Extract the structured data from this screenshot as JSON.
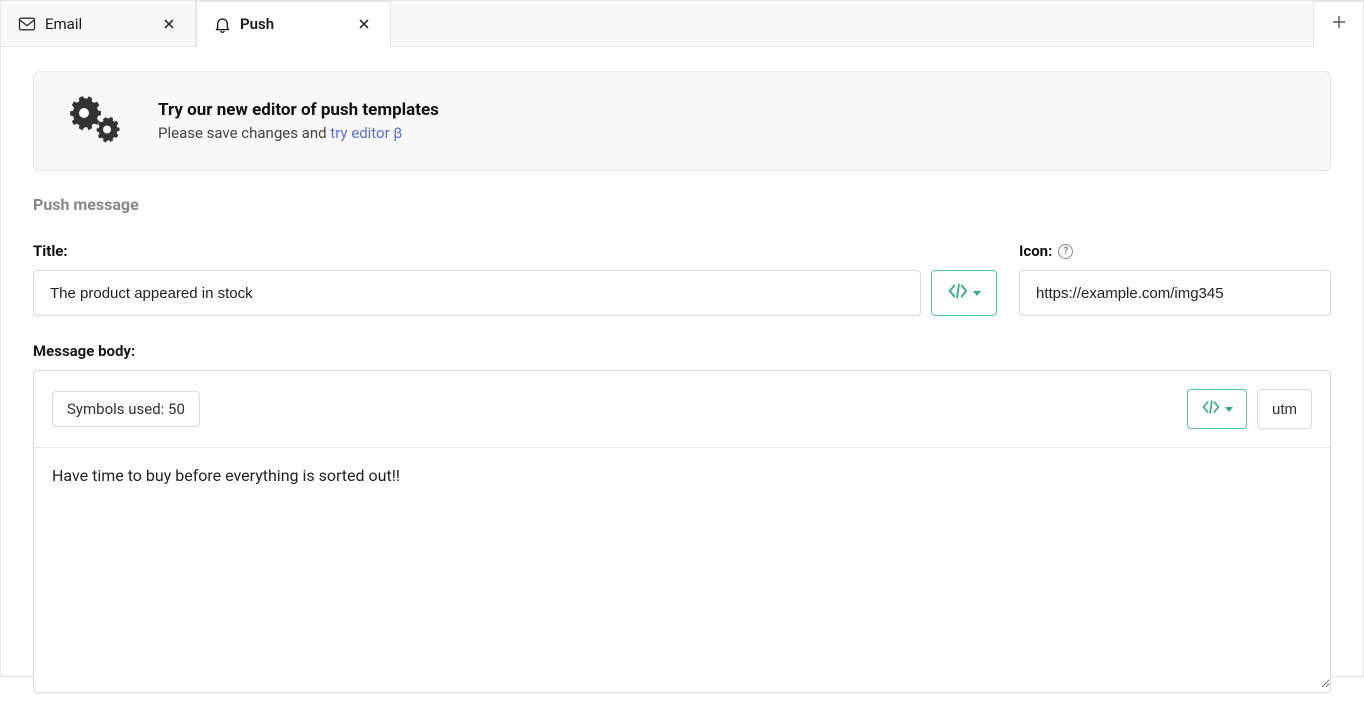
{
  "tabs": {
    "items": [
      {
        "label": "Email",
        "active": false
      },
      {
        "label": "Push",
        "active": true
      }
    ]
  },
  "banner": {
    "title": "Try our new editor of push templates",
    "sub_prefix": "Please save changes and ",
    "sub_link": "try editor β"
  },
  "section": {
    "heading": "Push message"
  },
  "title_field": {
    "label": "Title:",
    "value": "The product appeared in stock"
  },
  "icon_field": {
    "label": "Icon:",
    "value": "https://example.com/img345"
  },
  "body_field": {
    "label": "Message body:",
    "symbols_prefix": "Symbols used: ",
    "symbols_count": "50",
    "utm_label": "utm",
    "value": "Have time to buy before everything is sorted out!!"
  }
}
